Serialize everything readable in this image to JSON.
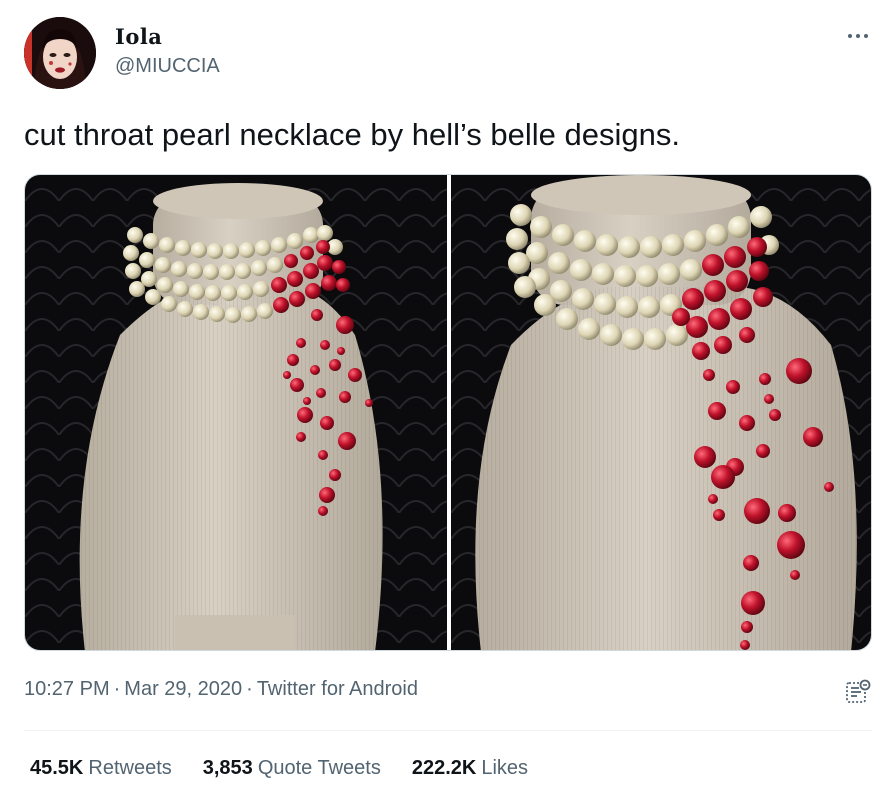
{
  "author": {
    "display_name": "Iola",
    "handle": "@MIUCCIA"
  },
  "tweet": {
    "text": "cut throat pearl necklace by hell’s belle designs.",
    "time": "10:27 PM",
    "date": "Mar 29, 2020",
    "source": "Twitter for Android",
    "media": [
      {
        "icon": "necklace-photo-front"
      },
      {
        "icon": "necklace-photo-angle"
      }
    ]
  },
  "stats": {
    "retweets_count": "45.5K",
    "retweets_label": "Retweets",
    "quotes_count": "3,853",
    "quotes_label": "Quote Tweets",
    "likes_count": "222.2K",
    "likes_label": "Likes"
  },
  "icons": {
    "more": "more-dots-icon",
    "analytics": "analytics-icon"
  },
  "colors": {
    "text_primary": "#0f1419",
    "text_secondary": "#536471",
    "divider": "#eff3f4",
    "bead_red": "#b3122a"
  }
}
